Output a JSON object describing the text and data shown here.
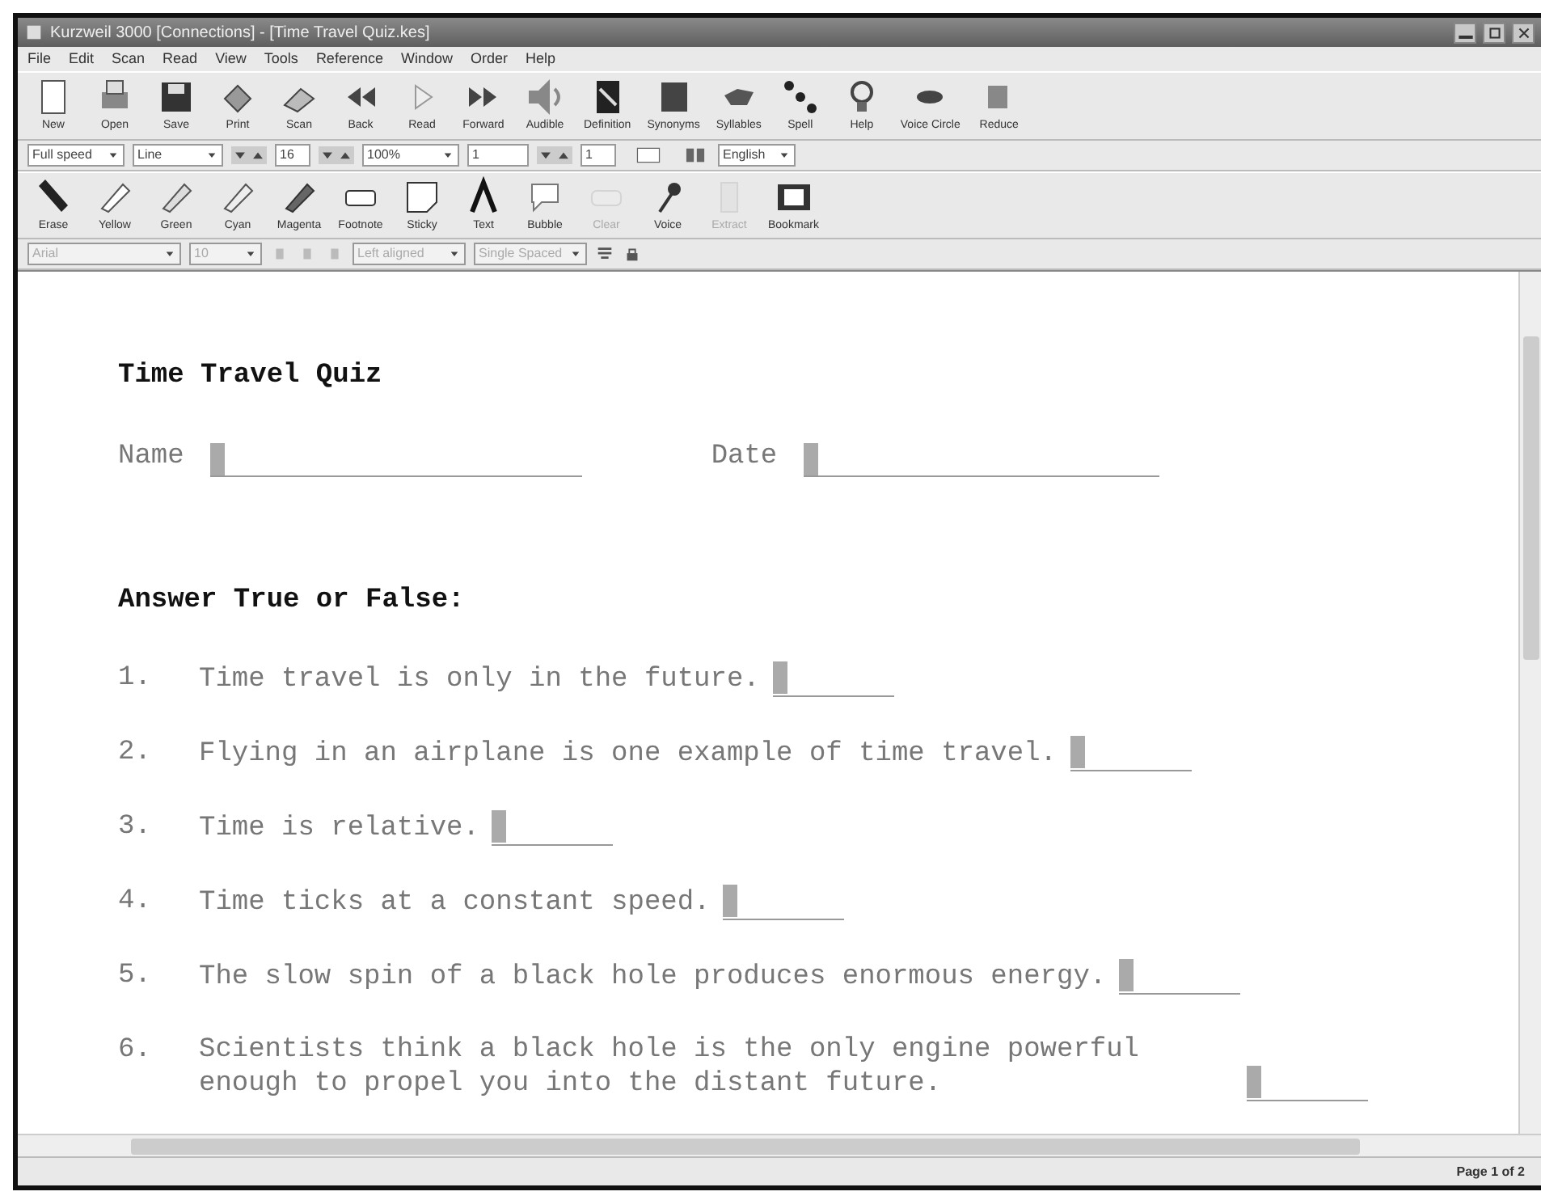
{
  "window": {
    "title": "Kurzweil 3000 [Connections] - [Time Travel Quiz.kes]"
  },
  "menu": [
    "File",
    "Edit",
    "Scan",
    "Read",
    "View",
    "Tools",
    "Reference",
    "Window",
    "Order",
    "Help"
  ],
  "main_toolbar": [
    "New",
    "Open",
    "Save",
    "Print",
    "Scan",
    "Back",
    "Read",
    "Forward",
    "Audible",
    "Definition",
    "Synonyms",
    "Syllables",
    "Spell",
    "Help",
    "Voice Circle",
    "Reduce"
  ],
  "format_bar": {
    "speed": "Full speed",
    "unit": "Line",
    "size": "16",
    "zoom": "100%",
    "page": "1",
    "field": "1",
    "language": "English"
  },
  "study_toolbar": [
    {
      "label": "Erase",
      "disabled": false
    },
    {
      "label": "Yellow",
      "disabled": false
    },
    {
      "label": "Green",
      "disabled": false
    },
    {
      "label": "Cyan",
      "disabled": false
    },
    {
      "label": "Magenta",
      "disabled": false
    },
    {
      "label": "Footnote",
      "disabled": false
    },
    {
      "label": "Sticky",
      "disabled": false
    },
    {
      "label": "Text",
      "disabled": false
    },
    {
      "label": "Bubble",
      "disabled": false
    },
    {
      "label": "Clear",
      "disabled": true
    },
    {
      "label": "Voice",
      "disabled": false
    },
    {
      "label": "Extract",
      "disabled": true
    },
    {
      "label": "Bookmark",
      "disabled": false
    }
  ],
  "font_bar": {
    "font": "Arial",
    "size": "10",
    "align": "Left aligned",
    "spacing": "Single Spaced"
  },
  "document": {
    "title": "Time Travel Quiz",
    "fields": [
      {
        "label": "Name"
      },
      {
        "label": "Date"
      }
    ],
    "instructions": "Answer True or False:",
    "questions": [
      {
        "number": "1.",
        "text": "Time travel is only in the future."
      },
      {
        "number": "2.",
        "text": "Flying in an airplane is one example of time travel."
      },
      {
        "number": "3.",
        "text": "Time is relative."
      },
      {
        "number": "4.",
        "text": "Time ticks at a constant speed."
      },
      {
        "number": "5.",
        "text": "The slow spin of a black hole produces enormous energy."
      },
      {
        "number": "6.",
        "text": "Scientists think a black hole is the only engine powerful enough to propel you into the distant future."
      }
    ]
  },
  "status_bar": "Page 1 of 2"
}
